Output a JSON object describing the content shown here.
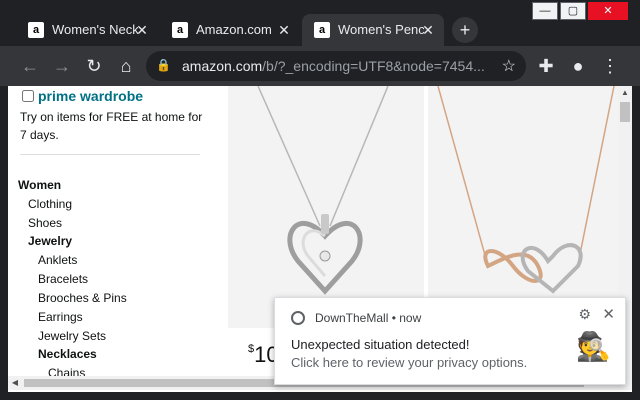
{
  "window": {
    "controls": {
      "minimize": "—",
      "maximize": "▢",
      "close": "✕"
    }
  },
  "tabs": [
    {
      "title": "Women's Neck",
      "favicon": "a",
      "active": false
    },
    {
      "title": "Amazon.com",
      "favicon": "a",
      "active": false
    },
    {
      "title": "Women's Penc",
      "favicon": "a",
      "active": true
    }
  ],
  "toolbar": {
    "url_host": "amazon.com",
    "url_path": "/b/?_encoding=UTF8&node=7454...",
    "icons": [
      "back-icon",
      "forward-icon",
      "reload-icon",
      "home-icon",
      "lock-icon",
      "star-icon",
      "extensions-icon",
      "profile-icon",
      "menu-icon"
    ]
  },
  "sidebar": {
    "prime_wardrobe": "prime wardrobe",
    "prime_desc": "Try on items for FREE at home for 7 days.",
    "categories": [
      {
        "label": "Women",
        "bold": true
      },
      {
        "label": "Clothing",
        "bold": false
      },
      {
        "label": "Shoes",
        "bold": false
      },
      {
        "label": "Jewelry",
        "bold": true
      },
      {
        "label": "Anklets",
        "bold": false
      },
      {
        "label": "Bracelets",
        "bold": false
      },
      {
        "label": "Brooches & Pins",
        "bold": false
      },
      {
        "label": "Earrings",
        "bold": false
      },
      {
        "label": "Jewelry Sets",
        "bold": false
      },
      {
        "label": "Necklaces",
        "bold": true
      },
      {
        "label": "Chains",
        "bold": false
      }
    ]
  },
  "products": [
    {
      "price_symbol": "$",
      "price_partial": "10"
    }
  ],
  "notification": {
    "app": "DownTheMall",
    "time": "now",
    "title": "Unexpected situation detected!",
    "body": "Click here to review your privacy options."
  },
  "colors": {
    "chrome_dark": "#202124",
    "toolbar": "#35363a",
    "amazon_link": "#007185"
  }
}
